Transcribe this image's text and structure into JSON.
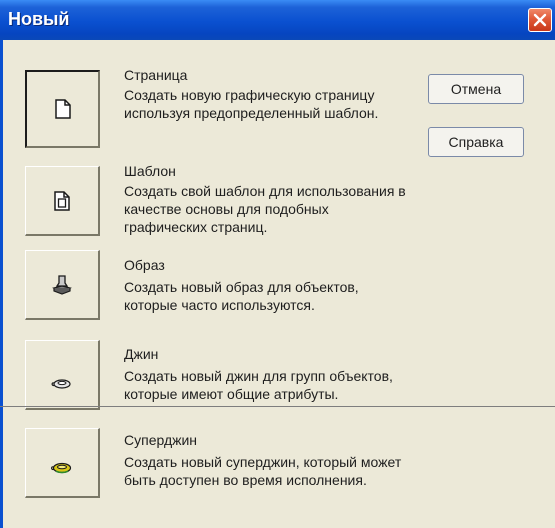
{
  "window": {
    "title": "Новый"
  },
  "items": [
    {
      "name": "Страница",
      "description": "Создать новую графическую страницу используя предопределенный шаблон.",
      "icon": "page-icon"
    },
    {
      "name": "Шаблон",
      "description": "Создать свой шаблон для использования в качестве основы для подобных графических страниц.",
      "icon": "template-icon"
    },
    {
      "name": "Образ",
      "description": "Создать новый образ для объектов, которые часто используются.",
      "icon": "stamp-icon"
    },
    {
      "name": "Джин",
      "description": "Создать новый джин для групп объектов, которые имеют общие атрибуты.",
      "icon": "genie-lamp-icon"
    },
    {
      "name": "Суперджин",
      "description": "Создать новый суперджин, который может быть доступен во время исполнения.",
      "icon": "supergenie-lamp-icon"
    }
  ],
  "buttons": {
    "cancel": "Отмена",
    "help": "Справка"
  },
  "colors": {
    "title_bar": "#0a50d0",
    "close_button": "#e05a38",
    "dialog_bg": "#ece9d8"
  }
}
